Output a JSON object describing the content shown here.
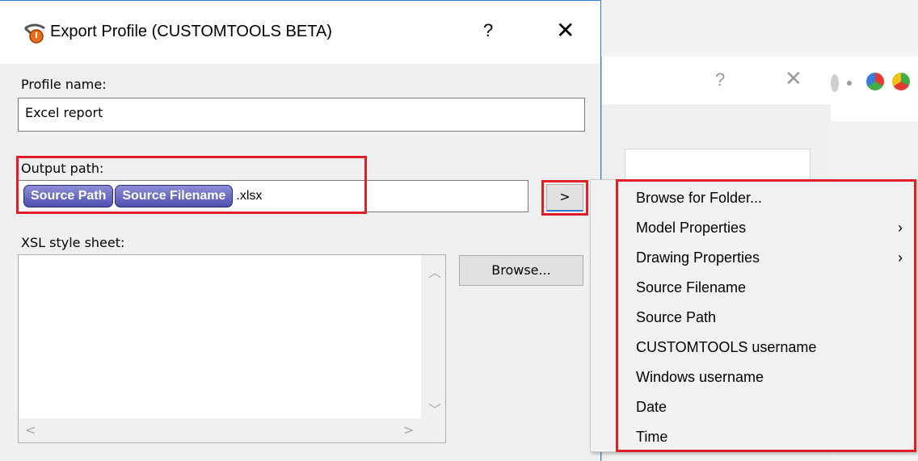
{
  "dialog": {
    "title": "Export Profile (CUSTOMTOOLS BETA)",
    "help": "?",
    "close": "✕"
  },
  "profile": {
    "label": "Profile name:",
    "value": "Excel report"
  },
  "output": {
    "label": "Output path:",
    "tokens": [
      "Source Path",
      "Source Filename"
    ],
    "suffix": ".xlsx",
    "button": ">"
  },
  "xsl": {
    "label": "XSL style sheet:",
    "browse": "Browse..."
  },
  "menu": {
    "items": [
      {
        "label": "Browse for Folder...",
        "submenu": false
      },
      {
        "label": "Model Properties",
        "submenu": true
      },
      {
        "label": "Drawing Properties",
        "submenu": true
      },
      {
        "label": "Source Filename",
        "submenu": false
      },
      {
        "label": "Source Path",
        "submenu": false
      },
      {
        "label": "CUSTOMTOOLS username",
        "submenu": false
      },
      {
        "label": "Windows username",
        "submenu": false
      },
      {
        "label": "Date",
        "submenu": false
      },
      {
        "label": "Time",
        "submenu": false
      }
    ],
    "submenu_arrow": "›"
  },
  "background_window": {
    "help": "?",
    "close": "✕"
  },
  "colors": {
    "highlight": "#e21f26",
    "token_fill": "#5a5ab8",
    "accent": "#2d7cd2"
  }
}
